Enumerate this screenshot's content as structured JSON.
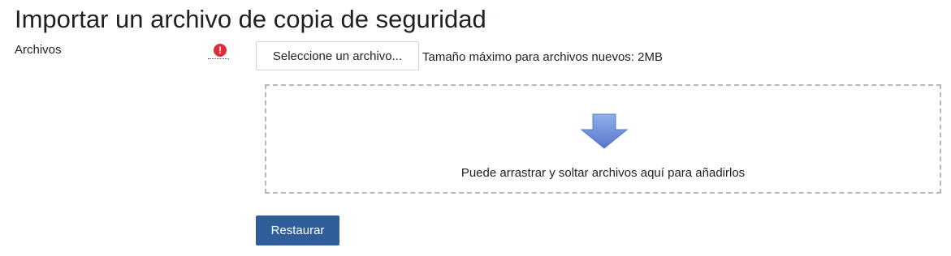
{
  "page": {
    "title": "Importar un archivo de copia de seguridad"
  },
  "form": {
    "files_label": "Archivos",
    "required_icon": "exclamation-circle-icon",
    "required_glyph": "!",
    "choose_file_label": "Seleccione un archivo...",
    "max_size_text": "Tamaño máximo para archivos nuevos: 2MB",
    "dropzone": {
      "icon": "download-arrow-icon",
      "text": "Puede arrastrar y soltar archivos aquí para añadirlos"
    },
    "submit_label": "Restaurar"
  },
  "colors": {
    "primary": "#2f5e9b",
    "required": "#e12d39",
    "arrow": "#6b8fd6"
  }
}
